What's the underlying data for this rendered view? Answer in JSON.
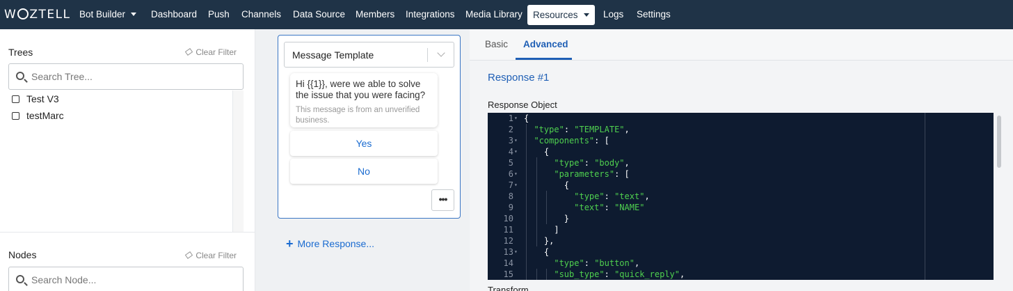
{
  "nav": {
    "logo": "WOZTELL",
    "items": [
      {
        "label": "Bot Builder",
        "dropdown": true
      },
      {
        "label": "Dashboard"
      },
      {
        "label": "Push"
      },
      {
        "label": "Channels"
      },
      {
        "label": "Data Source"
      },
      {
        "label": "Members"
      },
      {
        "label": "Integrations"
      },
      {
        "label": "Media Library"
      },
      {
        "label": "Resources",
        "dropdown": true,
        "active": true
      },
      {
        "label": "Logs"
      },
      {
        "label": "Settings"
      }
    ],
    "colors": {
      "bar": "#1f3347",
      "text": "#ffffff"
    }
  },
  "left": {
    "trees": {
      "title": "Trees",
      "clear_filter": "Clear Filter",
      "search_placeholder": "Search Tree...",
      "items": [
        "Test V3",
        "testMarc"
      ]
    },
    "nodes": {
      "title": "Nodes",
      "clear_filter": "Clear Filter",
      "search_placeholder": "Search Node..."
    }
  },
  "middle": {
    "select_value": "Message Template",
    "bubble": {
      "message": "Hi {{1}}, were we able to solve the issue that you were facing?",
      "note": "This message is from an unverified business."
    },
    "quick_replies": [
      "Yes",
      "No"
    ],
    "more_icon": "•••",
    "more_response": "More Response..."
  },
  "right": {
    "tabs": [
      {
        "label": "Basic",
        "active": false
      },
      {
        "label": "Advanced",
        "active": true
      }
    ],
    "response_title": "Response #1",
    "object_label": "Response Object",
    "next_label": "Transform",
    "accent": "#1f5fb5",
    "editor_bg": "#0e1b30",
    "code_lines": [
      {
        "n": "1",
        "fold": true,
        "text": "{"
      },
      {
        "n": "2",
        "fold": false,
        "text": "  \"type\": \"TEMPLATE\","
      },
      {
        "n": "3",
        "fold": true,
        "text": "  \"components\": ["
      },
      {
        "n": "4",
        "fold": true,
        "text": "    {"
      },
      {
        "n": "5",
        "fold": false,
        "text": "      \"type\": \"body\","
      },
      {
        "n": "6",
        "fold": true,
        "text": "      \"parameters\": ["
      },
      {
        "n": "7",
        "fold": true,
        "text": "        {"
      },
      {
        "n": "8",
        "fold": false,
        "text": "          \"type\": \"text\","
      },
      {
        "n": "9",
        "fold": false,
        "text": "          \"text\": \"NAME\""
      },
      {
        "n": "10",
        "fold": false,
        "text": "        }"
      },
      {
        "n": "11",
        "fold": false,
        "text": "      ]"
      },
      {
        "n": "12",
        "fold": false,
        "text": "    },"
      },
      {
        "n": "13",
        "fold": true,
        "text": "    {"
      },
      {
        "n": "14",
        "fold": false,
        "text": "      \"type\": \"button\","
      },
      {
        "n": "15",
        "fold": false,
        "text": "      \"sub_type\": \"quick_reply\","
      }
    ]
  }
}
